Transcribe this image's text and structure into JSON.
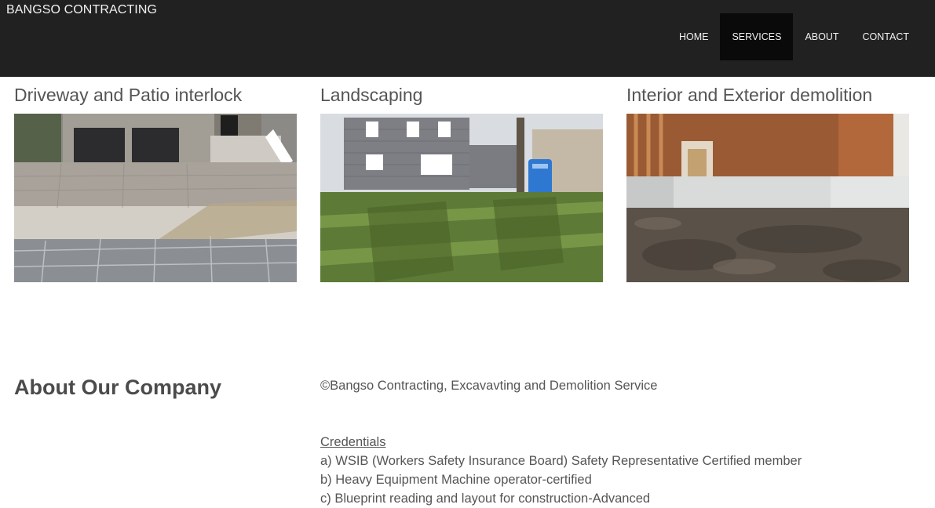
{
  "header": {
    "brand": "BANGSO CONTRACTING",
    "nav": [
      {
        "label": "HOME"
      },
      {
        "label": "SERVICES"
      },
      {
        "label": "ABOUT"
      },
      {
        "label": "CONTACT"
      }
    ]
  },
  "services": [
    {
      "title": "Driveway and Patio interlock"
    },
    {
      "title": "Landscaping"
    },
    {
      "title": "Interior and Exterior demolition"
    }
  ],
  "about": {
    "heading": "About Our Company",
    "copyright": "©Bangso Contracting, Excavavting and Demolition Service",
    "credentials_title": "Credentials",
    "credentials": [
      "a) WSIB (Workers Safety Insurance Board) Safety Representative Certified member",
      "b) Heavy Equipment Machine operator-certified",
      "c) Blueprint reading and layout for construction-Advanced"
    ]
  },
  "colors": {
    "header_bg": "#212121",
    "active_nav_bg": "#0a0a0a",
    "text": "#555555"
  }
}
